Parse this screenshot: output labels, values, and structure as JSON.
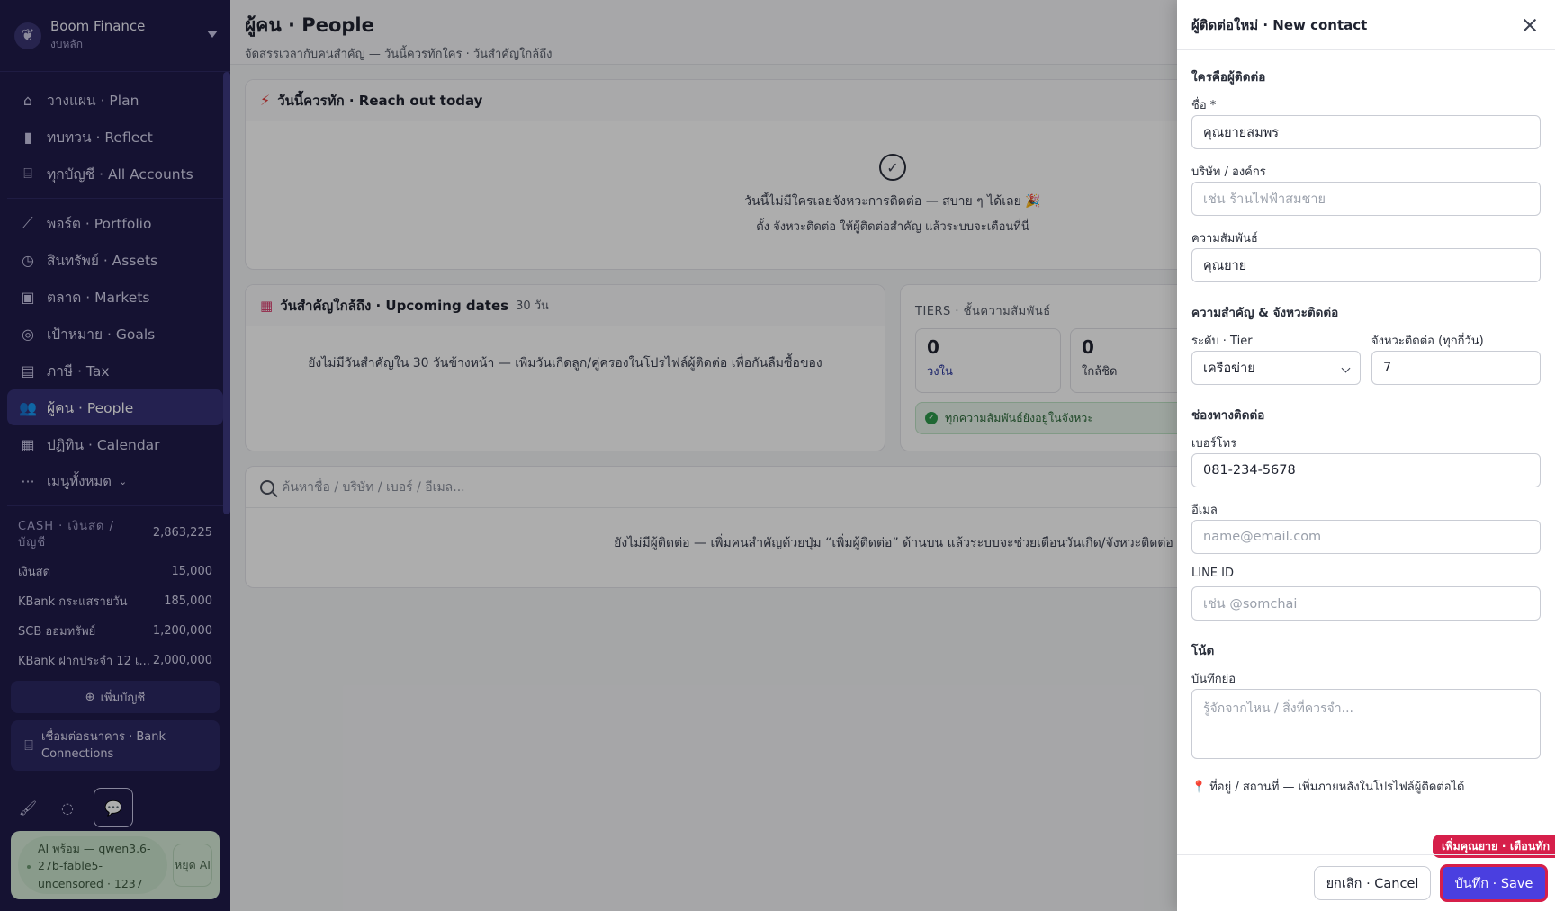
{
  "brand": {
    "name": "Boom Finance",
    "sub": "งบหลัก"
  },
  "nav": {
    "group1": [
      {
        "label": "วางแผน · Plan",
        "icon": "plan-icon"
      },
      {
        "label": "ทบทวน · Reflect",
        "icon": "bar-chart-icon"
      },
      {
        "label": "ทุกบัญชี · All Accounts",
        "icon": "bank-icon"
      }
    ],
    "group2": [
      {
        "label": "พอร์ต · Portfolio",
        "icon": "line-chart-icon"
      },
      {
        "label": "สินทรัพย์ · Assets",
        "icon": "watch-icon"
      },
      {
        "label": "ตลาด · Markets",
        "icon": "image-icon"
      },
      {
        "label": "เป้าหมาย · Goals",
        "icon": "target-icon"
      },
      {
        "label": "ภาษี · Tax",
        "icon": "document-icon"
      },
      {
        "label": "ผู้คน · People",
        "icon": "people-icon"
      },
      {
        "label": "ปฏิทิน · Calendar",
        "icon": "calendar-icon"
      }
    ],
    "more_label": "เมนูทั้งหมด"
  },
  "cash": {
    "header": "CASH · เงินสด / บัญชี",
    "total": "2,863,225",
    "rows": [
      {
        "name": "เงินสด",
        "amount": "15,000"
      },
      {
        "name": "KBank กระแสรายวัน",
        "amount": "185,000"
      },
      {
        "name": "SCB ออมทรัพย์",
        "amount": "1,200,000"
      },
      {
        "name": "KBank ฝากประจำ 12 เ...",
        "amount": "2,000,000"
      }
    ],
    "add_account": "เพิ่มบัญชี",
    "bank_connections": "เชื่อมต่อธนาคาร · Bank Connections"
  },
  "ai": {
    "status": "AI พร้อม — qwen3.6-27b-fable5-uncensored · 1237",
    "stop": "หยุด AI"
  },
  "page": {
    "title": "ผู้คน · People",
    "subtitle": "จัดสรรเวลากับคนสำคัญ — วันนี้ควรทักใคร · วันสำคัญใกล้ถึง"
  },
  "reach_out": {
    "title": "วันนี้ควรทัก · Reach out today",
    "empty_main": "วันนี้ไม่มีใครเลยจังหวะการติดต่อ — สบาย ๆ ได้เลย 🎉",
    "empty_sub": "ตั้ง จังหวะติดต่อ ให้ผู้ติดต่อสำคัญ แล้วระบบจะเตือนที่นี่"
  },
  "upcoming": {
    "title": "วันสำคัญใกล้ถึง · Upcoming dates",
    "range": "30 วัน",
    "empty": "ยังไม่มีวันสำคัญใน 30 วันข้างหน้า — เพิ่มวันเกิดลูก/คู่ครองในโปรไฟล์ผู้ติดต่อ เพื่อกันลืมซื้อของ"
  },
  "tiers": {
    "title": "TIERS · ชั้นความสัมพันธ์",
    "items": [
      {
        "count": "0",
        "label": "วงใน"
      },
      {
        "count": "0",
        "label": "ใกล้ชิด"
      }
    ],
    "ok_message": "ทุกความสัมพันธ์ยังอยู่ในจังหวะ"
  },
  "search": {
    "placeholder": "ค้นหาชื่อ / บริษัท / เบอร์ / อีเมล...",
    "empty": "ยังไม่มีผู้ติดต่อ — เพิ่มคนสำคัญด้วยปุ่ม “เพิ่มผู้ติดต่อ” ด้านบน แล้วระบบจะช่วยเตือนวันเกิด/จังหวะติดต่อ"
  },
  "drawer": {
    "title": "ผู้ติดต่อใหม่ · New contact",
    "section_who": "ใครคือผู้ติดต่อ",
    "name_label": "ชื่อ *",
    "name_value": "คุณยายสมพร",
    "company_label": "บริษัท / องค์กร",
    "company_placeholder": "เช่น ร้านไฟฟ้าสมชาย",
    "relation_label": "ความสัมพันธ์",
    "relation_value": "คุณยาย",
    "section_priority": "ความสำคัญ & จังหวะติดต่อ",
    "tier_label": "ระดับ · Tier",
    "tier_value": "เครือข่าย",
    "cadence_label": "จังหวะติดต่อ (ทุกกี่วัน)",
    "cadence_value": "7",
    "section_channels": "ช่องทางติดต่อ",
    "phone_label": "เบอร์โทร",
    "phone_value": "081-234-5678",
    "email_label": "อีเมล",
    "email_placeholder": "name@email.com",
    "line_label": "LINE ID",
    "line_placeholder": "เช่น @somchai",
    "section_notes": "โน้ต",
    "notes_label": "บันทึกย่อ",
    "notes_placeholder": "รู้จักจากไหน / สิ่งที่ควรจำ...",
    "location_hint": "ที่อยู่ / สถานที่ — เพิ่มภายหลังในโปรไฟล์ผู้ติดต่อได้",
    "cancel": "ยกเลิก · Cancel",
    "save": "บันทึก · Save",
    "tip": "เพิ่มคุณยาย · เตือนทัก"
  }
}
